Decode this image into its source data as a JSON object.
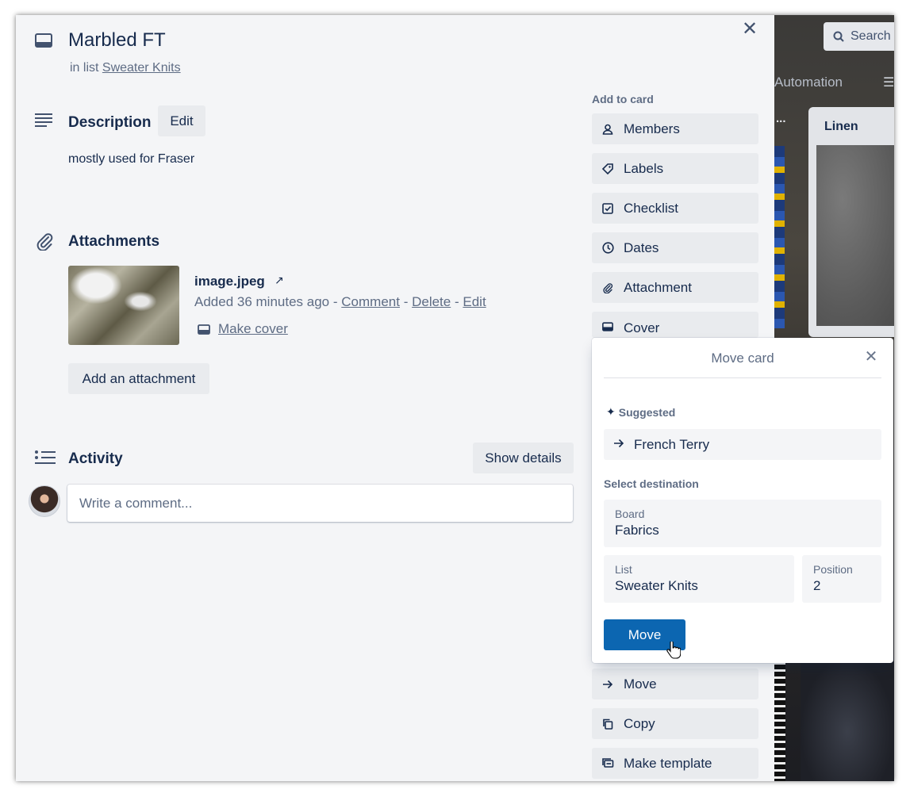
{
  "card": {
    "title": "Marbled FT",
    "in_list_prefix": "in list",
    "list_name": "Sweater Knits"
  },
  "description": {
    "title": "Description",
    "edit_label": "Edit",
    "text": "mostly used for Fraser"
  },
  "attachments": {
    "title": "Attachments",
    "file_name": "image.jpeg",
    "ext_icon": "↗",
    "added": "Added 36 minutes ago",
    "sep": "-",
    "comment_label": "Comment",
    "delete_label": "Delete",
    "edit_label": "Edit",
    "make_cover_label": "Make cover",
    "add_label": "Add an attachment"
  },
  "activity": {
    "title": "Activity",
    "show_details_label": "Show details",
    "comment_placeholder": "Write a comment..."
  },
  "sidebar": {
    "heading": "Add to card",
    "items": [
      {
        "label": "Members",
        "icon": "person-icon"
      },
      {
        "label": "Labels",
        "icon": "tag-icon"
      },
      {
        "label": "Checklist",
        "icon": "checkbox-icon"
      },
      {
        "label": "Dates",
        "icon": "clock-icon"
      },
      {
        "label": "Attachment",
        "icon": "paperclip-icon"
      },
      {
        "label": "Cover",
        "icon": "cover-icon"
      }
    ],
    "actions": [
      {
        "label": "Move",
        "icon": "arrow-right-icon"
      },
      {
        "label": "Copy",
        "icon": "copy-icon"
      },
      {
        "label": "Make template",
        "icon": "template-icon"
      }
    ]
  },
  "move_popover": {
    "title": "Move card",
    "suggested_label": "Suggested",
    "suggested_item": "French Terry",
    "select_destination_label": "Select destination",
    "board_label": "Board",
    "board_value": "Fabrics",
    "list_label": "List",
    "list_value": "Sweater Knits",
    "position_label": "Position",
    "position_value": "2",
    "move_button": "Move"
  },
  "board_bg": {
    "search_label": "Search",
    "automation_label": "Automation",
    "list_title": "Linen",
    "list_menu": "..."
  },
  "colors": {
    "primary_button": "#0c66b1",
    "modal_bg": "#f4f5f7",
    "text": "#172b4d",
    "subtle_text": "#5e6c84"
  }
}
